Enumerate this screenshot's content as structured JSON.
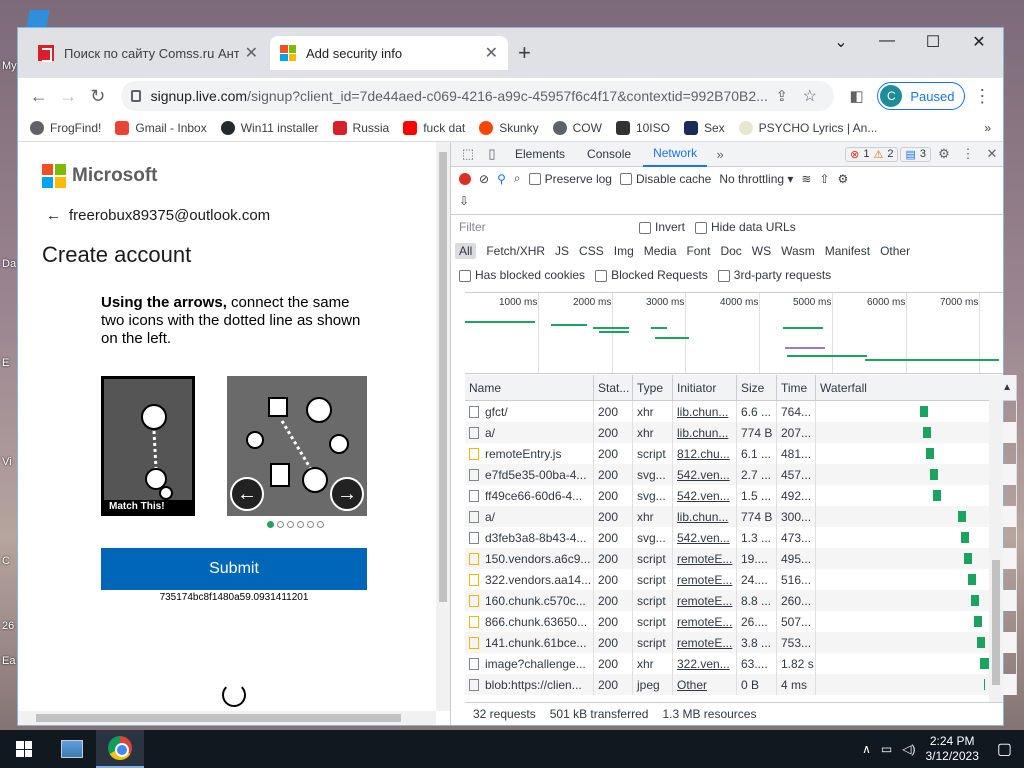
{
  "desktop": {
    "labels": [
      "My",
      "Da",
      "E",
      "Vi",
      "C",
      "26",
      "Ea"
    ]
  },
  "tabs": [
    {
      "title": "Поиск по сайту Comss.ru Антив",
      "active": false
    },
    {
      "title": "Add security info",
      "active": true
    }
  ],
  "window_controls": {
    "chevron": "⌄",
    "minimize": "—",
    "maximize": "☐",
    "close": "✕"
  },
  "address": {
    "host": "signup.live.com",
    "path": "/signup?client_id=7de44aed-c069-4216-a99c-45957f6c4f17&contextid=992B70B2..."
  },
  "profile": {
    "initial": "C",
    "status": "Paused"
  },
  "bookmarks": [
    "FrogFind!",
    "Gmail - Inbox",
    "Win11 installer",
    "Russia",
    "fuck dat",
    "Skunky",
    "COW",
    "10ISO",
    "Sex",
    "PSYCHO Lyrics | An..."
  ],
  "page": {
    "brand": "Microsoft",
    "email": "freerobux89375@outlook.com",
    "heading": "Create account",
    "instruction_bold": "Using the arrows,",
    "instruction_rest": " connect the same two icons with the dotted line as shown on the left.",
    "match_label": "Match This!",
    "submit_label": "Submit",
    "session_code": "735174bc8f1480a59.0931411201"
  },
  "devtools": {
    "tabs": [
      "Elements",
      "Console",
      "Network"
    ],
    "active_tab": "Network",
    "errors": "1",
    "warnings": "2",
    "messages": "3",
    "toolbar": {
      "preserve_log": "Preserve log",
      "disable_cache": "Disable cache",
      "throttle": "No throttling"
    },
    "filter_placeholder": "Filter",
    "invert": "Invert",
    "hide_data": "Hide data URLs",
    "types": [
      "All",
      "Fetch/XHR",
      "JS",
      "CSS",
      "Img",
      "Media",
      "Font",
      "Doc",
      "WS",
      "Wasm",
      "Manifest",
      "Other"
    ],
    "blocked_cookies": "Has blocked cookies",
    "blocked_requests": "Blocked Requests",
    "third_party": "3rd-party requests",
    "timeline_ticks": [
      "1000 ms",
      "2000 ms",
      "3000 ms",
      "4000 ms",
      "5000 ms",
      "6000 ms",
      "7000 ms"
    ],
    "columns": {
      "name": "Name",
      "status": "Stat...",
      "type": "Type",
      "initiator": "Initiator",
      "size": "Size",
      "time": "Time",
      "waterfall": "Waterfall"
    },
    "rows": [
      {
        "name": "gfct/",
        "status": "200",
        "type": "xhr",
        "initiator": "lib.chun...",
        "size": "6.6 ...",
        "time": "764...",
        "icon": "doc"
      },
      {
        "name": "a/",
        "status": "200",
        "type": "xhr",
        "initiator": "lib.chun...",
        "size": "774 B",
        "time": "207...",
        "icon": "doc"
      },
      {
        "name": "remoteEntry.js",
        "status": "200",
        "type": "script",
        "initiator": "812.chu...",
        "size": "6.1 ...",
        "time": "481...",
        "icon": "js"
      },
      {
        "name": "e7fd5e35-00ba-4...",
        "status": "200",
        "type": "svg...",
        "initiator": "542.ven...",
        "size": "2.7 ...",
        "time": "457...",
        "icon": "svg"
      },
      {
        "name": "ff49ce66-60d6-4...",
        "status": "200",
        "type": "svg...",
        "initiator": "542.ven...",
        "size": "1.5 ...",
        "time": "492...",
        "icon": "svg"
      },
      {
        "name": "a/",
        "status": "200",
        "type": "xhr",
        "initiator": "lib.chun...",
        "size": "774 B",
        "time": "300...",
        "icon": "doc"
      },
      {
        "name": "d3feb3a8-8b43-4...",
        "status": "200",
        "type": "svg...",
        "initiator": "542.ven...",
        "size": "1.3 ...",
        "time": "473...",
        "icon": "svg"
      },
      {
        "name": "150.vendors.a6c9...",
        "status": "200",
        "type": "script",
        "initiator": "remoteE...",
        "size": "19....",
        "time": "495...",
        "icon": "js"
      },
      {
        "name": "322.vendors.aa14...",
        "status": "200",
        "type": "script",
        "initiator": "remoteE...",
        "size": "24....",
        "time": "516...",
        "icon": "js"
      },
      {
        "name": "160.chunk.c570c...",
        "status": "200",
        "type": "script",
        "initiator": "remoteE...",
        "size": "8.8 ...",
        "time": "260...",
        "icon": "js"
      },
      {
        "name": "866.chunk.63650...",
        "status": "200",
        "type": "script",
        "initiator": "remoteE...",
        "size": "26....",
        "time": "507...",
        "icon": "js"
      },
      {
        "name": "141.chunk.61bce...",
        "status": "200",
        "type": "script",
        "initiator": "remoteE...",
        "size": "3.8 ...",
        "time": "753...",
        "icon": "js"
      },
      {
        "name": "image?challenge...",
        "status": "200",
        "type": "xhr",
        "initiator": "322.ven...",
        "size": "63....",
        "time": "1.82 s",
        "icon": "doc"
      },
      {
        "name": "blob:https://clien...",
        "status": "200",
        "type": "jpeg",
        "initiator": "Other",
        "size": "0 B",
        "time": "4 ms",
        "icon": "img"
      }
    ],
    "status_bar": {
      "requests": "32 requests",
      "transferred": "501 kB transferred",
      "resources": "1.3 MB resources"
    }
  },
  "taskbar": {
    "time": "2:24 PM",
    "date": "3/12/2023"
  }
}
